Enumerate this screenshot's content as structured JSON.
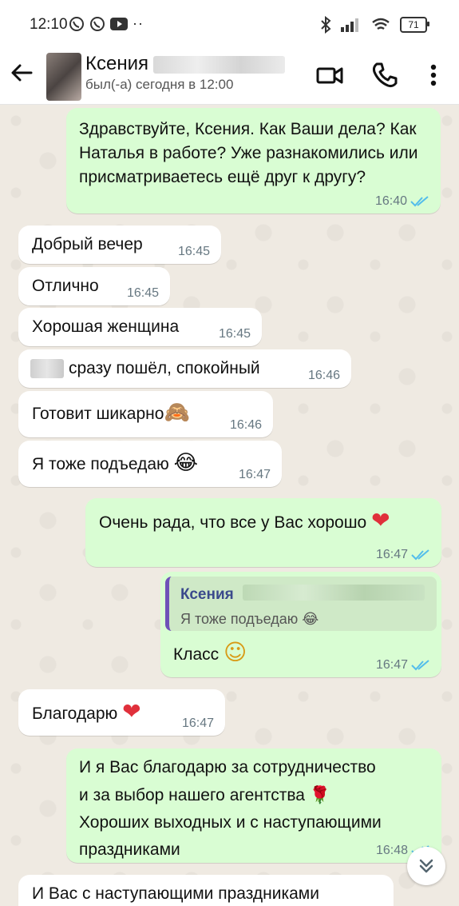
{
  "status_bar": {
    "time": "12:10",
    "battery": "71"
  },
  "header": {
    "contact_name": "Ксения",
    "last_seen": "был(-а) сегодня в 12:00"
  },
  "messages": [
    {
      "text": "Здравствуйте, Ксения. Как Ваши дела? Как Наталья в работе? Уже разнакомились или присматриваетесь ещё друг к другу?",
      "time": "16:40"
    },
    {
      "text": "Добрый вечер",
      "time": "16:45"
    },
    {
      "text": "Отлично",
      "time": "16:45"
    },
    {
      "text": "Хорошая женщина",
      "time": "16:45"
    },
    {
      "text": "сразу пошёл, спокойный",
      "time": "16:46"
    },
    {
      "text": "Готовит шикарно",
      "emoji": "🙈",
      "time": "16:46"
    },
    {
      "text": "Я тоже подъедаю",
      "emoji": "😂",
      "time": "16:47"
    },
    {
      "text": "Очень рада, что все у Вас хорошо",
      "emoji": "❤",
      "time": "16:47"
    },
    {
      "quote_name": "Ксения",
      "quote_text": "Я тоже подъедаю",
      "quote_emoji": "😂",
      "text": "Класс",
      "emoji": "☺",
      "time": "16:47"
    },
    {
      "text": "Благодарю",
      "emoji": "❤",
      "time": "16:47"
    },
    {
      "line1": "И я Вас благодарю за сотрудничество",
      "line2": "и за выбор нашего агентства",
      "emoji": "🌹",
      "line3": "Хороших выходных и с наступающими",
      "line4": "праздниками",
      "time": "16:48"
    },
    {
      "text": "И Вас с наступающими праздниками"
    }
  ],
  "colors": {
    "incoming": "#ffffff",
    "outgoing": "#d9fdd3",
    "read_tick": "#53bdeb",
    "quote_bar": "#6e51b8"
  },
  "icons": [
    "back-arrow-icon",
    "video-call-icon",
    "phone-icon",
    "more-icon",
    "double-check-icon",
    "scroll-down-icon"
  ]
}
